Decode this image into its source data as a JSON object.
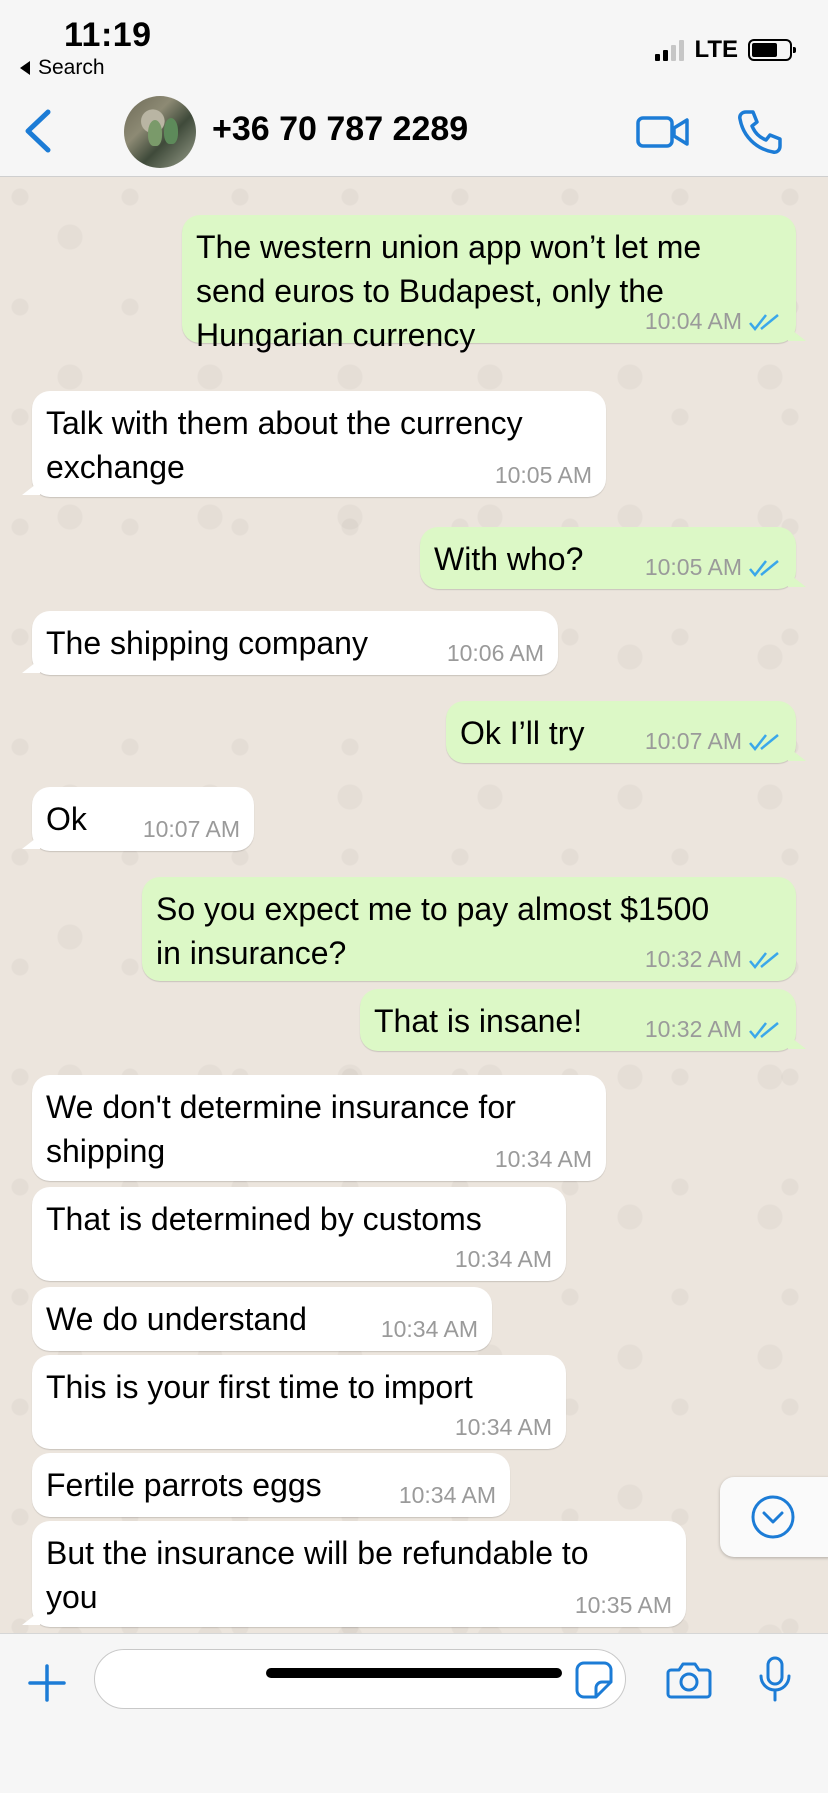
{
  "status_bar": {
    "time": "11:19",
    "back_label": "Search",
    "network": "LTE"
  },
  "header": {
    "contact_name": "+36 70 787 2289"
  },
  "messages": [
    {
      "direction": "out",
      "text": "The western union app won’t let me\nsend euros to Budapest, only the\nHungarian currency",
      "time": "10:04 AM",
      "read": true
    },
    {
      "direction": "in",
      "text": "Talk with them about the currency\nexchange",
      "time": "10:05 AM"
    },
    {
      "direction": "out",
      "text": "With who?",
      "time": "10:05 AM",
      "read": true
    },
    {
      "direction": "in",
      "text": "The shipping company",
      "time": "10:06 AM"
    },
    {
      "direction": "out",
      "text": "Ok I’ll try",
      "time": "10:07 AM",
      "read": true
    },
    {
      "direction": "in",
      "text": "Ok",
      "time": "10:07 AM"
    },
    {
      "direction": "out",
      "text": "So you expect me to pay almost $1500\nin insurance?",
      "time": "10:32 AM",
      "read": true
    },
    {
      "direction": "out",
      "text": "That is insane!",
      "time": "10:32 AM",
      "read": true
    },
    {
      "direction": "in",
      "text": "We don't determine insurance for\nshipping",
      "time": "10:34 AM"
    },
    {
      "direction": "in",
      "text": "That is determined by customs",
      "time": "10:34 AM"
    },
    {
      "direction": "in",
      "text": "We do understand",
      "time": "10:34 AM"
    },
    {
      "direction": "in",
      "text": "This is your first time to import",
      "time": "10:34 AM"
    },
    {
      "direction": "in",
      "text": "Fertile parrots eggs",
      "time": "10:34 AM"
    },
    {
      "direction": "in",
      "text": "But the insurance will be refundable to\nyou",
      "time": "10:35 AM"
    }
  ],
  "input": {
    "value": ""
  },
  "colors": {
    "accent": "#1c7cd6",
    "outgoing": "#dcf8c6",
    "incoming": "#ffffff",
    "chat_bg": "#ece5dd"
  }
}
